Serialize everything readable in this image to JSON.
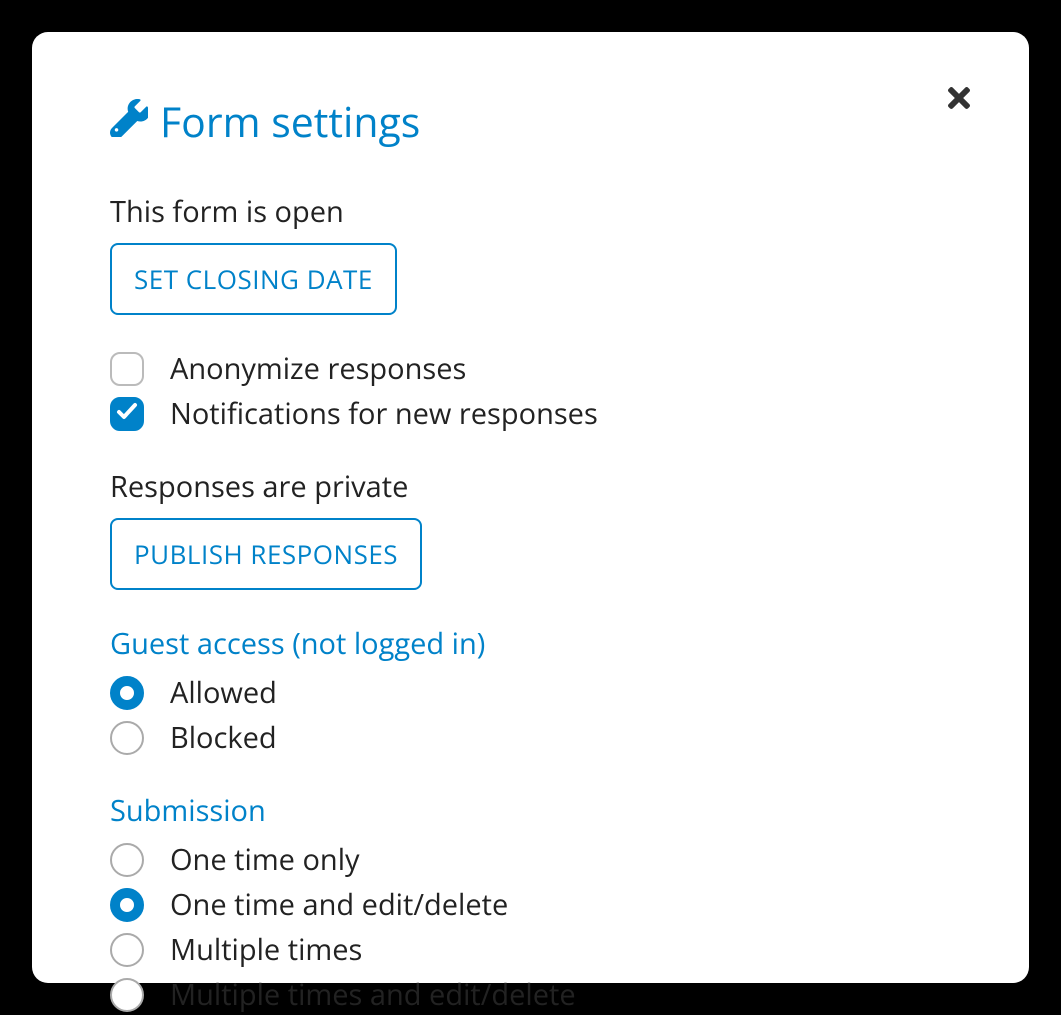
{
  "dialog": {
    "title": "Form settings"
  },
  "status": {
    "open_text": "This form is open",
    "set_closing_date_btn": "SET CLOSING DATE",
    "responses_private_text": "Responses are private",
    "publish_responses_btn": "PUBLISH RESPONSES"
  },
  "checkboxes": {
    "anonymize": {
      "label": "Anonymize responses",
      "checked": false
    },
    "notifications": {
      "label": "Notifications for new responses",
      "checked": true
    }
  },
  "guest_access": {
    "header": "Guest access (not logged in)",
    "options": [
      {
        "label": "Allowed",
        "selected": true
      },
      {
        "label": "Blocked",
        "selected": false
      }
    ]
  },
  "submission": {
    "header": "Submission",
    "options": [
      {
        "label": "One time only",
        "selected": false
      },
      {
        "label": "One time and edit/delete",
        "selected": true
      },
      {
        "label": "Multiple times",
        "selected": false
      },
      {
        "label": "Multiple times and edit/delete",
        "selected": false
      }
    ]
  }
}
